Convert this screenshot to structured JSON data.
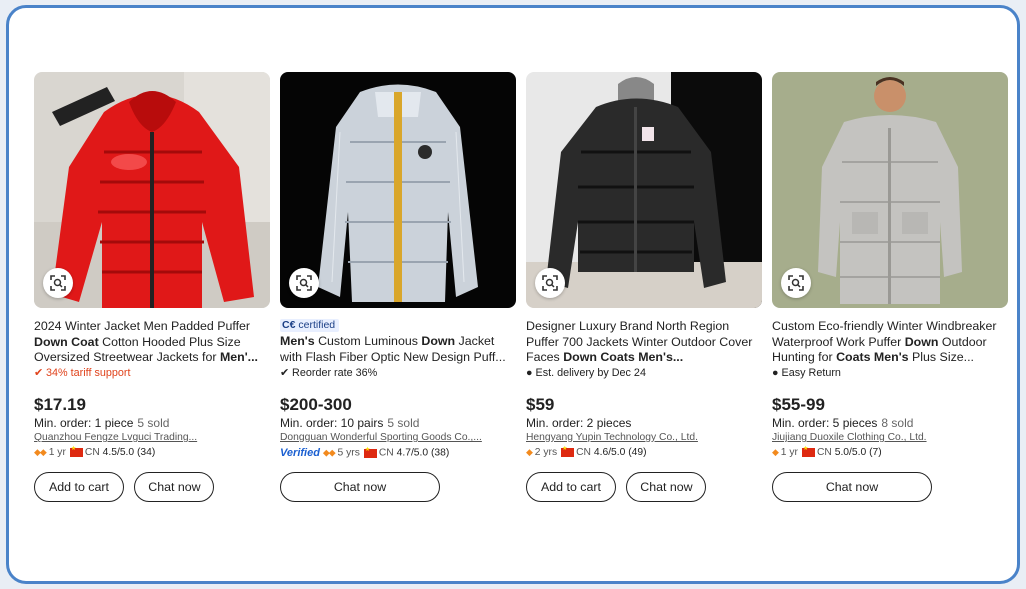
{
  "products": [
    {
      "title_parts": [
        {
          "t": "2024 Winter Jacket Men Padded Puffer ",
          "b": false
        },
        {
          "t": "Down Coat",
          "b": true
        },
        {
          "t": " Cotton Hooded Plus Size Oversized Streetwear Jackets for ",
          "b": false
        },
        {
          "t": "Men'...",
          "b": true
        }
      ],
      "certified": "",
      "tag": "34% tariff support",
      "price": "$17.19",
      "min_order": "Min. order: 1 piece",
      "sold": "5 sold",
      "supplier": "Quanzhou Fengze Lvguci Trading...",
      "verified": "",
      "years": "1 yr",
      "country": "CN",
      "rating": "4.5/5.0 (34)",
      "buttons": [
        "Add to cart",
        "Chat now"
      ]
    },
    {
      "title_parts": [
        {
          "t": "Men's",
          "b": true
        },
        {
          "t": " Custom Luminous ",
          "b": false
        },
        {
          "t": "Down",
          "b": true
        },
        {
          "t": " Jacket with Flash Fiber Optic New Design Puff...",
          "b": false
        }
      ],
      "certified": "certified",
      "tag": "Reorder rate 36%",
      "price": "$200-300",
      "min_order": "Min. order: 10 pairs",
      "sold": "5 sold",
      "supplier": "Dongguan Wonderful Sporting Goods Co.,...",
      "verified": "Verified",
      "years": "5 yrs",
      "country": "CN",
      "rating": "4.7/5.0 (38)",
      "buttons": [
        "Chat now"
      ]
    },
    {
      "title_parts": [
        {
          "t": "Designer Luxury Brand North Region Puffer 700 Jackets Winter Outdoor Cover Faces ",
          "b": false
        },
        {
          "t": "Down Coats Men's...",
          "b": true
        }
      ],
      "certified": "",
      "tag": "Est. delivery by Dec 24",
      "price": "$59",
      "min_order": "Min. order: 2 pieces",
      "sold": "",
      "supplier": "Hengyang Yupin Technology Co., Ltd.",
      "verified": "",
      "years": "2 yrs",
      "country": "CN",
      "rating": "4.6/5.0 (49)",
      "buttons": [
        "Add to cart",
        "Chat now"
      ]
    },
    {
      "title_parts": [
        {
          "t": "Custom Eco-friendly Winter Windbreaker Waterproof Work Puffer ",
          "b": false
        },
        {
          "t": "Down",
          "b": true
        },
        {
          "t": " Outdoor Hunting for ",
          "b": false
        },
        {
          "t": "Coats Men's",
          "b": true
        },
        {
          "t": " Plus Size...",
          "b": false
        }
      ],
      "certified": "",
      "tag": "Easy Return",
      "price": "$55-99",
      "min_order": "Min. order: 5 pieces",
      "sold": "8 sold",
      "supplier": "Jiujiang Duoxile Clothing Co., Ltd.",
      "verified": "",
      "years": "1 yr",
      "country": "CN",
      "rating": "5.0/5.0 (7)",
      "buttons": [
        "Chat now"
      ]
    }
  ],
  "colors": {
    "accent_red": "#e0431c",
    "verified_blue": "#1a5fd1",
    "frame_border": "#4a83c9"
  }
}
